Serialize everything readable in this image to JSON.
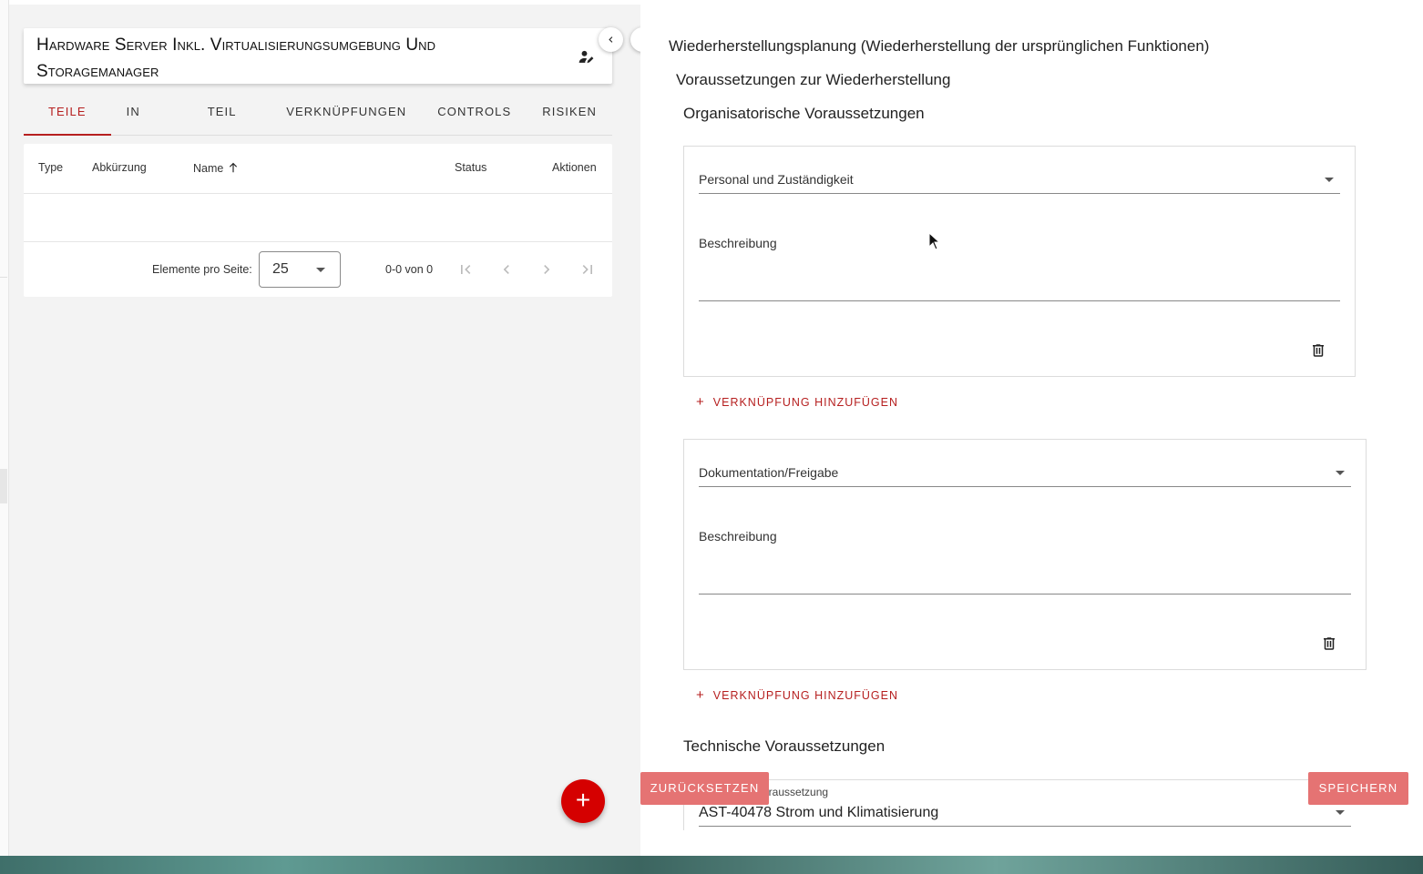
{
  "left": {
    "title": "Hardware Server Inkl. Virtualisierungsumgebung Und Storagemanager",
    "tabs": [
      {
        "label": "Teile",
        "active": true
      },
      {
        "label": "In Scope",
        "active": false
      },
      {
        "label": "Teil von",
        "active": false
      },
      {
        "label": "Verknüpfungen",
        "active": false
      },
      {
        "label": "Controls",
        "active": false
      },
      {
        "label": "Risiken",
        "active": false
      }
    ],
    "table": {
      "columns": [
        "Type",
        "Abkürzung",
        "Name",
        "Status",
        "Aktionen"
      ],
      "sort_column": "Name",
      "rows": []
    },
    "paginator": {
      "items_per_page_label": "Elemente pro Seite:",
      "items_per_page": "25",
      "range": "0-0 von 0"
    },
    "fab_label": "+"
  },
  "right": {
    "heading": "Wiederherstellungsplanung (Wiederherstellung der ursprünglichen Funktionen)",
    "subheading": "Voraussetzungen zur Wiederherstellung",
    "org_section": "Organisatorische Voraussetzungen",
    "groups": [
      {
        "select": "Personal und Zuständigkeit",
        "description_label": "Beschreibung",
        "description": ""
      },
      {
        "select": "Dokumentation/Freigabe",
        "description_label": "Beschreibung",
        "description": ""
      }
    ],
    "add_link_label": "Verknüpfung hinzufügen",
    "tech_section": "Technische Voraussetzungen",
    "tech_field_label": "oraussetzung",
    "tech_field_value": "AST-40478 Strom und Klimatisierung"
  },
  "actions": {
    "reset": "Zurücksetzen",
    "save": "Speichern"
  },
  "colors": {
    "accent": "#b61f1f",
    "fab": "#d50000",
    "button": "#e57373"
  }
}
